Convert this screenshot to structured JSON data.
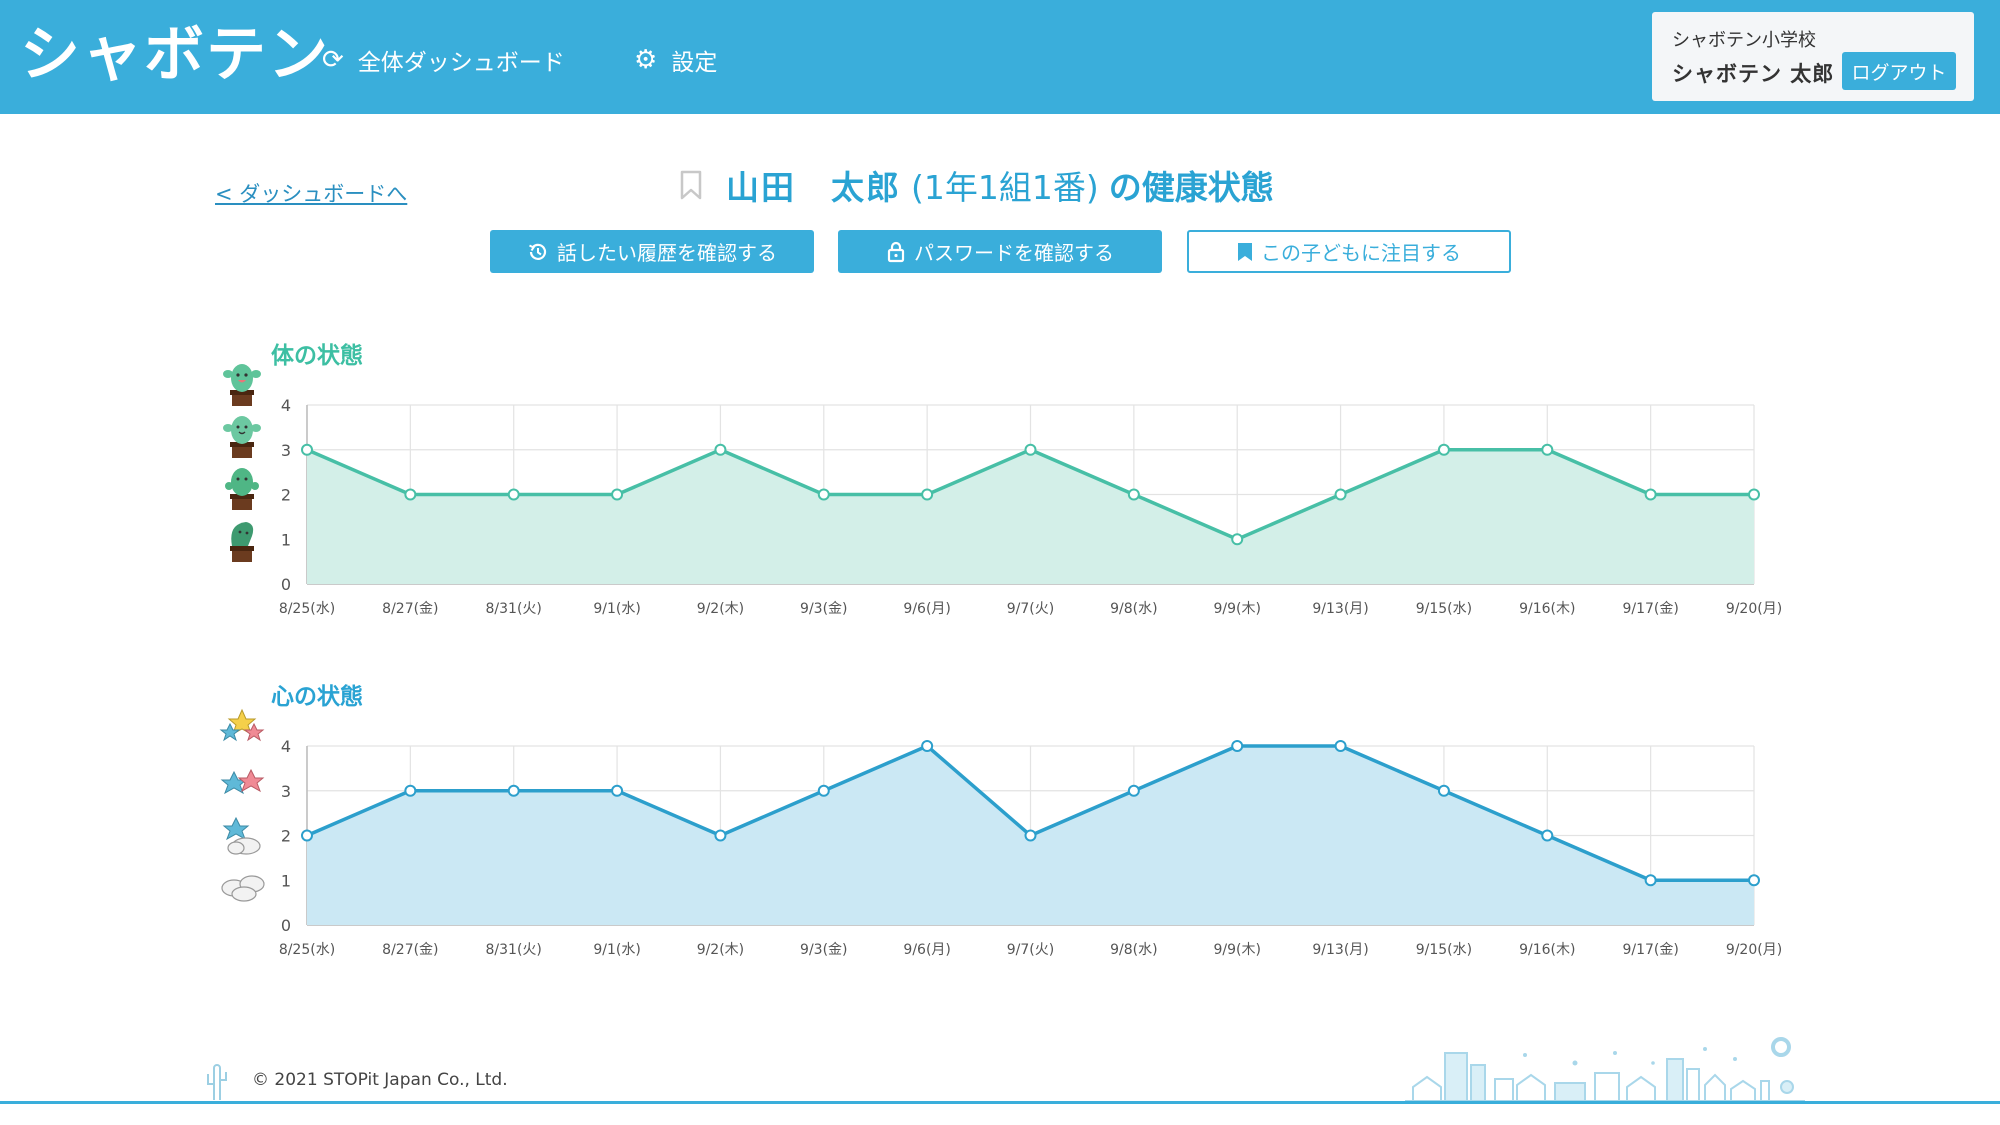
{
  "header": {
    "logo": "シャボテン",
    "nav": [
      {
        "label": "全体ダッシュボード",
        "icon": "refresh-icon"
      },
      {
        "label": "設定",
        "icon": "gear-icon"
      }
    ],
    "school": "シャボテン小学校",
    "user": "シャボテン 太郎",
    "logout_label": "ログアウト"
  },
  "page": {
    "back_link": "< ダッシュボードへ",
    "student_name": "山田　太郎",
    "student_class": "(1年1組1番)",
    "title_suffix": "の健康状態"
  },
  "actions": {
    "history_label": "話したい履歴を確認する",
    "password_label": "パスワードを確認する",
    "watch_label": "この子どもに注目する"
  },
  "colors": {
    "header": "#3aaedb",
    "body_line": "#47bfa6",
    "body_fill": "#d3efe8",
    "mind_line": "#2c9fcc",
    "mind_fill": "#cbe8f4"
  },
  "chart_data": [
    {
      "type": "area",
      "title": "体の状態",
      "categories": [
        "8/25(水)",
        "8/27(金)",
        "8/31(火)",
        "9/1(水)",
        "9/2(木)",
        "9/3(金)",
        "9/6(月)",
        "9/7(火)",
        "9/8(水)",
        "9/9(木)",
        "9/13(月)",
        "9/15(水)",
        "9/16(木)",
        "9/17(金)",
        "9/20(月)"
      ],
      "values": [
        3,
        2,
        2,
        2,
        3,
        2,
        2,
        3,
        2,
        1,
        2,
        3,
        3,
        2,
        2
      ],
      "ylim": [
        0,
        4
      ],
      "yticks": [
        0,
        1,
        2,
        3,
        4
      ],
      "grid": true,
      "level_icons": [
        "cactus-happy-icon",
        "cactus-smile-icon",
        "cactus-neutral-icon",
        "cactus-droop-icon"
      ]
    },
    {
      "type": "area",
      "title": "心の状態",
      "categories": [
        "8/25(水)",
        "8/27(金)",
        "8/31(火)",
        "9/1(水)",
        "9/2(木)",
        "9/3(金)",
        "9/6(月)",
        "9/7(火)",
        "9/8(水)",
        "9/9(木)",
        "9/13(月)",
        "9/15(水)",
        "9/16(木)",
        "9/17(金)",
        "9/20(月)"
      ],
      "values": [
        2,
        3,
        3,
        3,
        2,
        3,
        4,
        2,
        3,
        4,
        4,
        3,
        2,
        1,
        1
      ],
      "ylim": [
        0,
        4
      ],
      "yticks": [
        0,
        1,
        2,
        3,
        4
      ],
      "grid": true,
      "level_icons": [
        "three-stars-icon",
        "two-stars-icon",
        "star-cloud-icon",
        "clouds-icon"
      ]
    }
  ],
  "footer": {
    "copyright": "© 2021 STOPit Japan Co., Ltd."
  }
}
